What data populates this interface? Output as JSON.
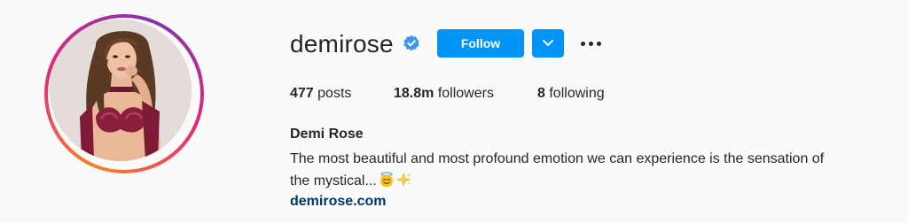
{
  "profile": {
    "username": "demirose",
    "verified": true,
    "verified_icon": "verified-badge-icon",
    "follow_label": "Follow",
    "dropdown_icon": "chevron-down-icon",
    "more_icon": "more-options-icon",
    "avatar_icon": "profile-photo",
    "stats": {
      "posts_count": "477",
      "posts_label": "posts",
      "followers_count": "18.8m",
      "followers_label": "followers",
      "following_count": "8",
      "following_label": "following"
    },
    "full_name": "Demi Rose",
    "bio_line1": "The most beautiful and most profound emotion we can experience is the sensation of",
    "bio_line2": "the mystical...",
    "bio_emojis": [
      "smiling-face-with-halo-icon",
      "sparkles-icon"
    ],
    "website": "demirose.com"
  },
  "colors": {
    "accent": "#0095f6",
    "text": "#262626",
    "link": "#00376b",
    "background": "#fafafa",
    "verified": "#3897f0"
  }
}
